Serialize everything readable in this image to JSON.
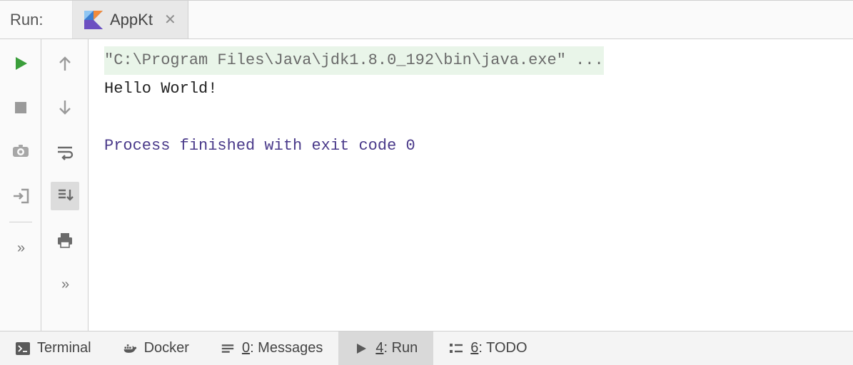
{
  "header": {
    "title": "Run:",
    "tab": {
      "label": "AppKt",
      "icon": "kotlin-icon"
    }
  },
  "toolbar_left": {
    "run": "run-icon",
    "stop": "stop-icon",
    "screenshot": "camera-icon",
    "exit": "exit-icon",
    "more": "»"
  },
  "toolbar_mid": {
    "up": "arrow-up-icon",
    "down": "arrow-down-icon",
    "wrap": "soft-wrap-icon",
    "scroll": "scroll-to-end-icon",
    "print": "print-icon",
    "more": "»"
  },
  "console": {
    "command": "\"C:\\Program Files\\Java\\jdk1.8.0_192\\bin\\java.exe\" ...",
    "output": "Hello World!",
    "exit_line": "Process finished with exit code 0"
  },
  "bottombar": {
    "terminal": "Terminal",
    "docker": "Docker",
    "messages_prefix": "0",
    "messages_suffix": ": Messages",
    "run_prefix": "4",
    "run_suffix": ": Run",
    "todo_prefix": "6",
    "todo_suffix": ": TODO"
  }
}
